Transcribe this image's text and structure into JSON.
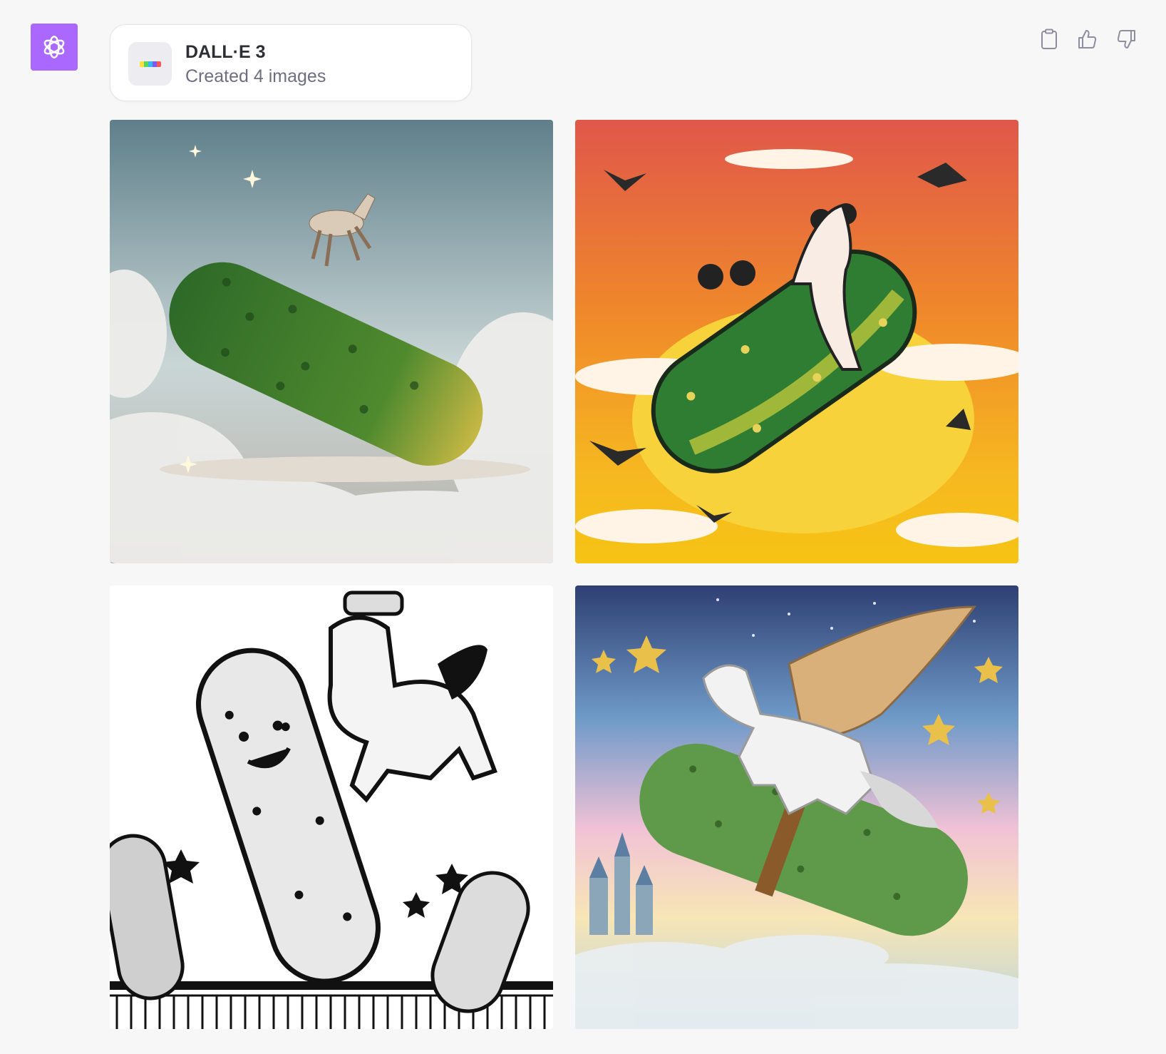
{
  "assistant": {
    "avatar_icon": "openai-logo-icon",
    "avatar_color": "#ab68ff"
  },
  "tool_card": {
    "title": "DALL·E 3",
    "subtitle": "Created 4 images",
    "thumb_icon": "color-spectrum-icon"
  },
  "actions": [
    {
      "icon": "clipboard-icon"
    },
    {
      "icon": "thumbs-up-icon"
    },
    {
      "icon": "thumbs-down-icon"
    }
  ],
  "images": [
    {
      "subject": "photoreal-pickle-horse-clouds"
    },
    {
      "subject": "retro-pickle-horse-sunglasses-birds"
    },
    {
      "subject": "ink-cartoon-cowboy-horse-pickle"
    },
    {
      "subject": "watercolor-pegasus-pickle-stars"
    }
  ]
}
